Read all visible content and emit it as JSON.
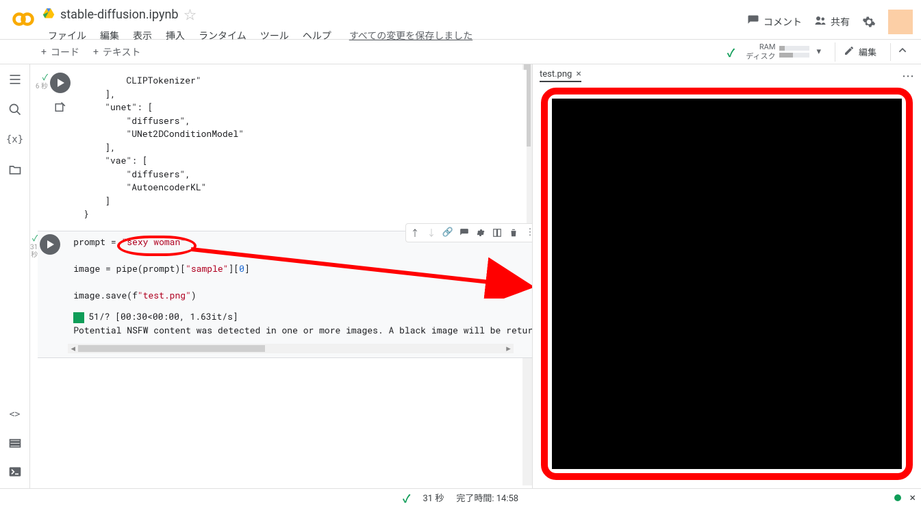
{
  "header": {
    "title": "stable-diffusion.ipynb",
    "menus": {
      "file": "ファイル",
      "edit": "編集",
      "view": "表示",
      "insert": "挿入",
      "runtime": "ランタイム",
      "tools": "ツール",
      "help": "ヘルプ"
    },
    "saved": "すべての変更を保存しました",
    "right": {
      "comment": "コメント",
      "share": "共有"
    }
  },
  "toolbar": {
    "code_btn": "コード",
    "text_btn": "テキスト",
    "resource": {
      "ram": "RAM",
      "disk": "ディスク"
    },
    "edit_btn": "編集"
  },
  "cells": {
    "c0": {
      "gutter_time": "6 秒",
      "code": "        CLIPTokenizer\"\n    ],\n    \"unet\": [\n        \"diffusers\",\n        \"UNet2DConditionModel\"\n    ],\n    \"vae\": [\n        \"diffusers\",\n        \"AutoencoderKL\"\n    ]\n}"
    },
    "c1": {
      "gutter_time1": "31",
      "gutter_time2": "秒",
      "l1_a": "prompt = ",
      "l1_str": "\"sexy woman\"",
      "l3_a": "image = pipe(prompt)[",
      "l3_s1": "\"sample\"",
      "l3_b": "][",
      "l3_n": "0",
      "l3_c": "]",
      "l5_a": "image.save(f",
      "l5_s": "\"test.png\"",
      "l5_b": ")",
      "out_progress": "51/? [00:30<00:00, 1.63it/s]",
      "out_warn": "Potential NSFW content was detected in one or more images. A black image will be return"
    }
  },
  "output_pane": {
    "tab": "test.png"
  },
  "footer": {
    "exec_time": "31 秒",
    "complete_label": "完了時間: 14:58"
  }
}
